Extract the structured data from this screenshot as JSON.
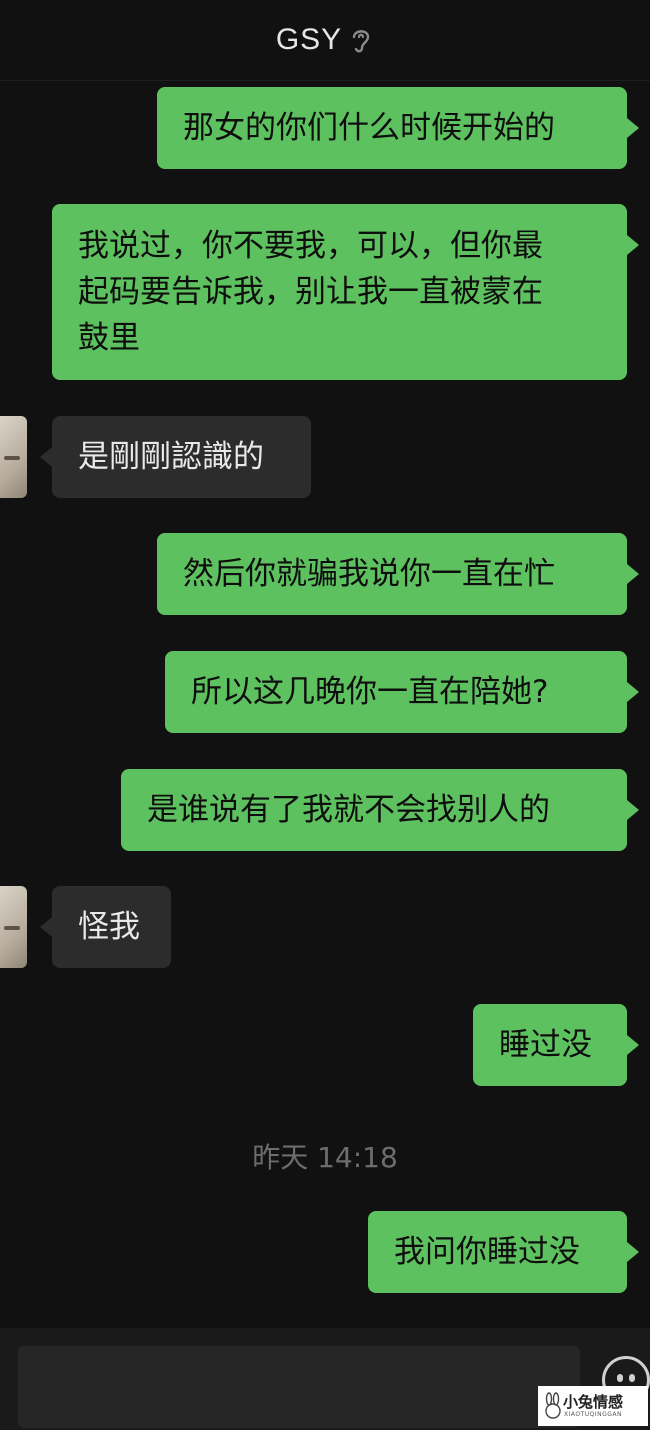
{
  "header": {
    "title": "GSY",
    "icon": "ear-icon"
  },
  "messages": [
    {
      "from": "me",
      "text": "那女的你们什么时候开始的"
    },
    {
      "from": "me",
      "text": "我说过，你不要我，可以，但你最\n起码要告诉我，别让我一直被蒙在\n鼓里"
    },
    {
      "from": "other",
      "text": "是剛剛認識的"
    },
    {
      "from": "me",
      "text": "然后你就骗我说你一直在忙"
    },
    {
      "from": "me",
      "text": "所以这几晚你一直在陪她?"
    },
    {
      "from": "me",
      "text": "是谁说有了我就不会找别人的"
    },
    {
      "from": "other",
      "text": "怪我"
    },
    {
      "from": "me",
      "text": "睡过没"
    },
    {
      "from": "me",
      "text": "我问你睡过没"
    }
  ],
  "timestamp": "昨天 14:18",
  "input_bar": {
    "placeholder": "",
    "emoji_icon": "emoji-icon"
  },
  "watermark": {
    "main": "小兔情感",
    "sub": "XIAOTUQINGGAN"
  },
  "colors": {
    "my_bubble": "#5ec15f",
    "other_bubble": "#2c2c2c",
    "background": "#111111"
  }
}
